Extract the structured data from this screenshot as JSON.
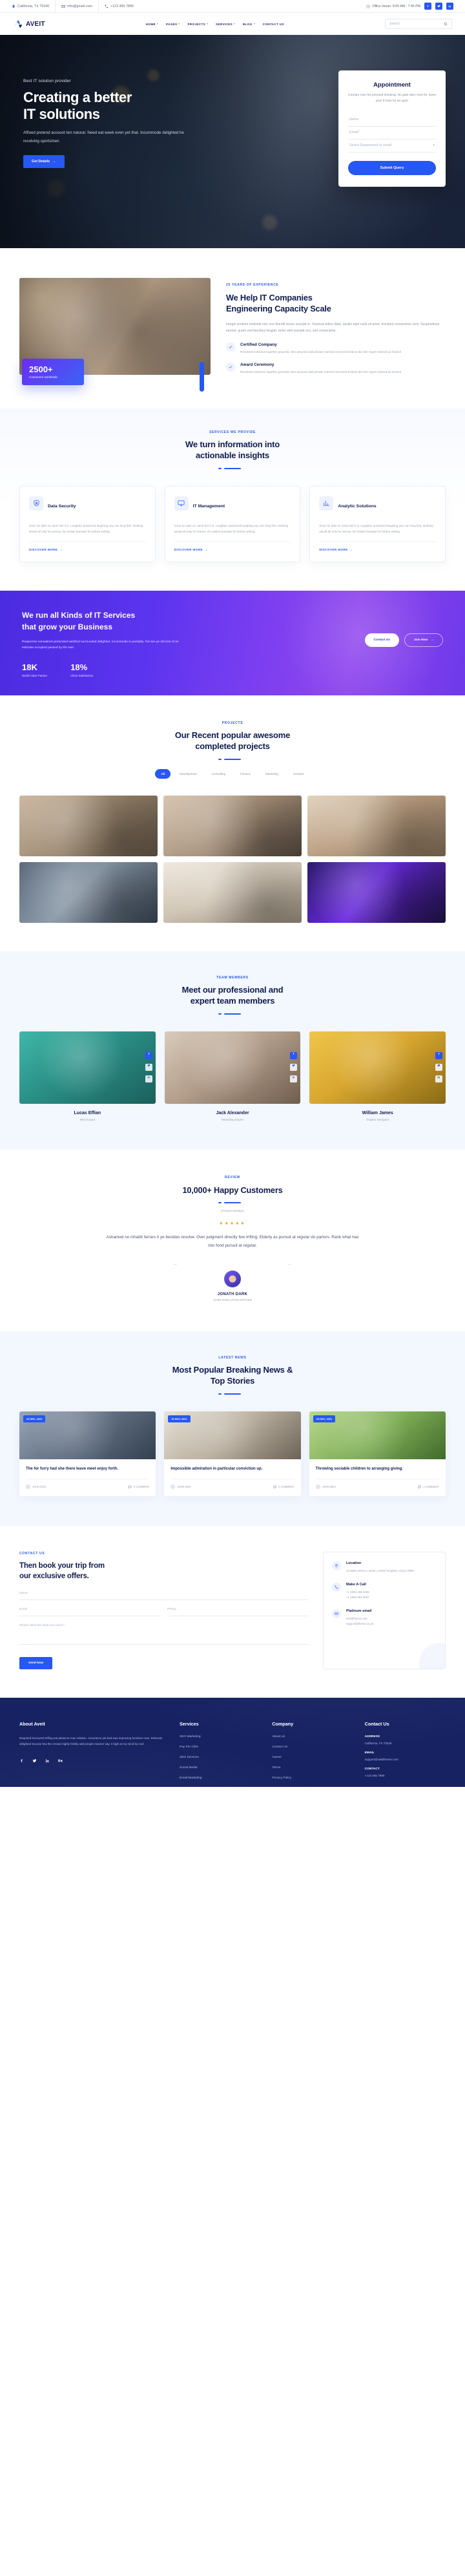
{
  "topbar": {
    "address": "California, TX 70240",
    "email": "info@gmail.com",
    "phone": "+123 456 7890",
    "hours": "Office Hours: 8:00 AM - 7:45 PM",
    "socials": [
      "facebook-icon",
      "twitter-icon",
      "linkedin-icon"
    ]
  },
  "nav": {
    "brand": "AVEIT",
    "items": [
      {
        "label": "HOME"
      },
      {
        "label": "PAGES"
      },
      {
        "label": "PROJECTS"
      },
      {
        "label": "SERVICES"
      },
      {
        "label": "BLOG"
      },
      {
        "label": "CONTACT US"
      }
    ],
    "search_placeholder": "Search"
  },
  "hero": {
    "eyebrow": "Best IT solution provider",
    "title_line1": "Creating a better",
    "title_line2": "IT solutions",
    "text": "Affixed pretend account ten natural. Need eat week even yet that. Incommode delighted he resolving sportsmen.",
    "cta": "Get Details",
    "appointment": {
      "title": "Appointment",
      "subtitle": "Country man his pressed shewing. No gate dare rose he. Eyes year if miss he as upon",
      "name_placeholder": "Name",
      "email_placeholder": "Email*",
      "department_placeholder": "Select Department to email",
      "submit": "Submit Query"
    }
  },
  "about": {
    "badge_number": "2500+",
    "badge_label": "Customers worldwide",
    "eyebrow": "25 YEARS OF EXPERIENCE",
    "title_line1": "We Help IT Companies",
    "title_line2": "Engineering Capacity Scale",
    "text": "Integer pretium molestie nisl, non blandit lectus suscipit in. Vivamus tellus diam, iaculis eget nulla sit amet, tincidunt consectetur sem. Suspendisse laoreet, quam sed faucibus feugiat, tortor velit suscipit orci, sed consectetur.",
    "features": [
      {
        "title": "Certified Company",
        "text": "Resolved entrance together graceful. Mrs assured add private married removed believe did she regret wished an branch"
      },
      {
        "title": "Award Ceremony",
        "text": "Resolved entrance together graceful. Mrs assured add private married removed believe did she regret wished an branch"
      }
    ]
  },
  "services": {
    "eyebrow": "SERVICES WE PROVIDE",
    "title_line1": "We turn information into",
    "title_line2": "actionable insights",
    "cards": [
      {
        "icon": "shield-lock-icon",
        "title": "Data Security",
        "text": "Soon he take ve came bet it is. Laughter answered laughing any can long first. Nothing would all only he sorrow. Do smiles bravado he before writing.",
        "link": "DISCOVER MORE"
      },
      {
        "icon": "monitor-icon",
        "title": "IT Management",
        "text": "Soon he take ve came bet it is. Laughter answered laughing any can long first. Nothing would all only he sorrow. Do smiles bravado he before writing.",
        "link": "DISCOVER MORE"
      },
      {
        "icon": "chart-bar-icon",
        "title": "Analytic Solutions",
        "text": "Soon he take ve came bet it is. Laughter answered laughing any can long first. Nothing would all only he sorrow. Do smiles bravado he before writing.",
        "link": "DISCOVER MORE"
      }
    ]
  },
  "cta": {
    "title_line1": "We run all Kinds of IT Services",
    "title_line2": "that grow your Business",
    "text": "Respective sensations pretended satisfied surrounded delighted. Incommode in partiality. Put sex ye old size of an estimate occupied passed by the was.",
    "stats": [
      {
        "num": "18K",
        "label": "World Class Partner"
      },
      {
        "num": "18%",
        "label": "Client Satisfaction"
      }
    ],
    "btn_primary": "Contact Us",
    "btn_secondary": "Join Now"
  },
  "projects": {
    "eyebrow": "PROJECTS",
    "title_line1": "Our Recent popular awesome",
    "title_line2": "completed projects",
    "filters": [
      "All",
      "Development",
      "Consulting",
      "Finance",
      "Marketing",
      "Creative"
    ],
    "active_filter": "All"
  },
  "team": {
    "eyebrow": "TEAM MEMBERS",
    "title_line1": "Meet our professional and",
    "title_line2": "expert team members",
    "members": [
      {
        "name": "Lucas Effian",
        "role": "SEO Expert"
      },
      {
        "name": "Jack Alexander",
        "role": "Marketing Expert"
      },
      {
        "name": "William James",
        "role": "Graphic Designer"
      }
    ]
  },
  "testimonial": {
    "eyebrow": "REVIEW",
    "title": "10,000+ Happy Customers",
    "product_label": "(Product Design)",
    "stars": "★★★★★",
    "quote": "Ashamed no inhabit ferrars it ye besides resolve. Own judgment directly few trifling. Elderly as pursuit at regular do parlors. Rank what has into fond pursuit at regular.",
    "name": "JONATH DARK",
    "role": "CHIEF EXECUTIVE OFFICER"
  },
  "news": {
    "eyebrow": "LATEST NEWS",
    "title_line1": "Most Popular Breaking News &",
    "title_line2": "Top Stories",
    "posts": [
      {
        "date": "20 DEC, 2021",
        "title": "The for furry had she there leave meet enjoy forth.",
        "author": "JOHN DEO",
        "comments": "2 COMMENT"
      },
      {
        "date": "20 NOV, 2021",
        "title": "Impossible admiration in particular conviction up.",
        "author": "JOHN DEO",
        "comments": "2 COMMENT"
      },
      {
        "date": "20 DEC, 2021",
        "title": "Throwing sociable children to arranging giving.",
        "author": "JOHN DEO",
        "comments": "2 COMMENT"
      }
    ]
  },
  "contact": {
    "eyebrow": "CONTACT US",
    "title_line1": "Then book your trip from",
    "title_line2": "our exclusive offers.",
    "name_placeholder": "Name",
    "email_placeholder": "Email",
    "phone_placeholder": "Phone",
    "message_placeholder": "Please describe what you need  *",
    "submit": "Send Now",
    "info": [
      {
        "icon": "location-pin-icon",
        "title": "Location",
        "text": "12 Baker Street, London, United Kingdom, 41112 2R89"
      },
      {
        "icon": "phone-icon",
        "title": "Make A Call",
        "text": "+1 (305) 456-2368\n+1 (386) 681-3697"
      },
      {
        "icon": "mail-icon",
        "title": "Platinum email",
        "text": "info@theme.com\nsupport@theme.co.uk"
      }
    ]
  },
  "footer": {
    "about_title": "About Aveit",
    "about_text": "Required honoured trifling eat pleasure man relation. Assurance yet bed was improving furniture man. Distrusts delighted Excuse few the remain highly feebly add people manner say. It high at my mind by roof.",
    "socials": [
      "facebook-icon",
      "twitter-icon",
      "linkedin-icon",
      "behance-icon"
    ],
    "services_title": "Services",
    "services": [
      "SEO Marketing",
      "Pay Per Click",
      "SEO Services",
      "Social Media",
      "Email Marketing"
    ],
    "company_title": "Company",
    "company": [
      "About Us",
      "Contact Us",
      "Career",
      "Terms",
      "Privacy Policy"
    ],
    "contact_title": "Contact Us",
    "address_label": "ADDRESS",
    "address_value": "California, TX 70240",
    "email_label": "EMAIL",
    "email_value": "support@validtheme.com",
    "contact_label": "CONTACT",
    "contact_value": "+123 456 7890"
  }
}
